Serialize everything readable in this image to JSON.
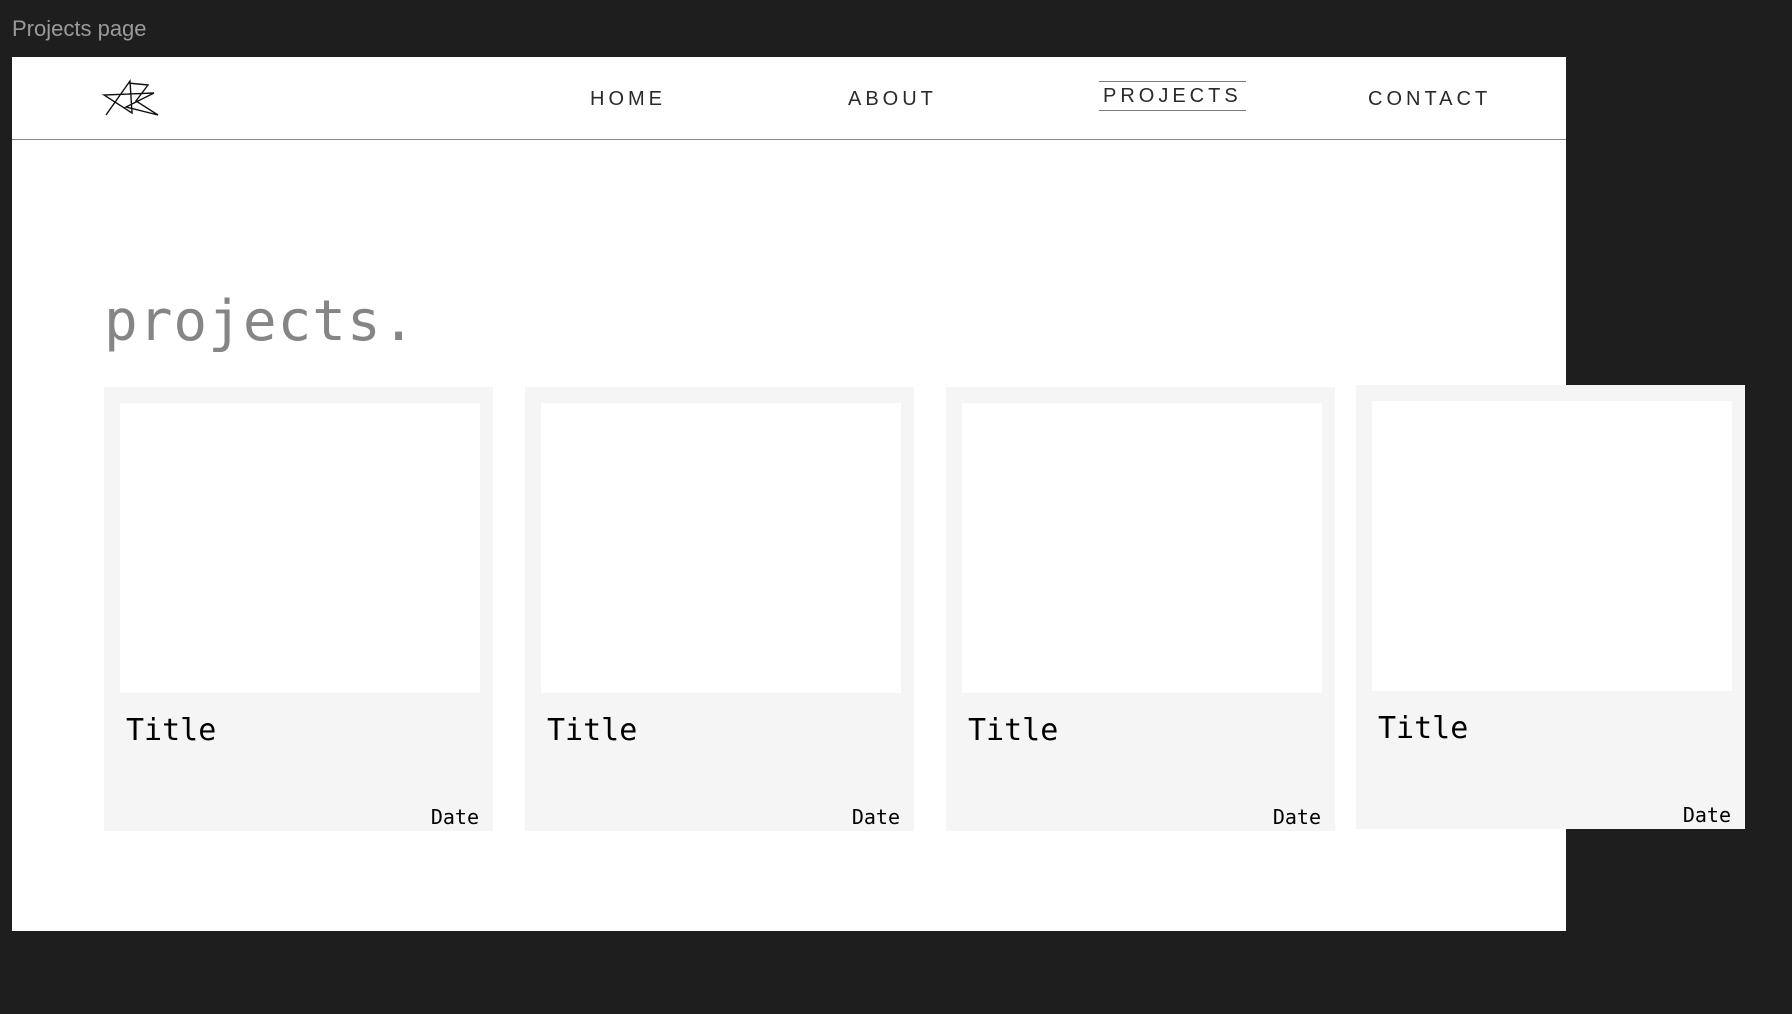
{
  "frame_label": "Projects page",
  "nav": {
    "logo_icon": "ab-star-logo-icon",
    "items": [
      {
        "label": "HOME",
        "active": false
      },
      {
        "label": "ABOUT",
        "active": false
      },
      {
        "label": "PROJECTS",
        "active": true
      },
      {
        "label": "CONTACT",
        "active": false
      }
    ]
  },
  "heading": "projects.",
  "cards": [
    {
      "title": "Title",
      "date": "Date"
    },
    {
      "title": "Title",
      "date": "Date"
    },
    {
      "title": "Title",
      "date": "Date"
    },
    {
      "title": "Title",
      "date": "Date"
    }
  ],
  "colors": {
    "canvas_bg": "#1e1e1e",
    "frame_bg": "#ffffff",
    "card_bg": "#f5f5f5",
    "heading": "#858585"
  }
}
